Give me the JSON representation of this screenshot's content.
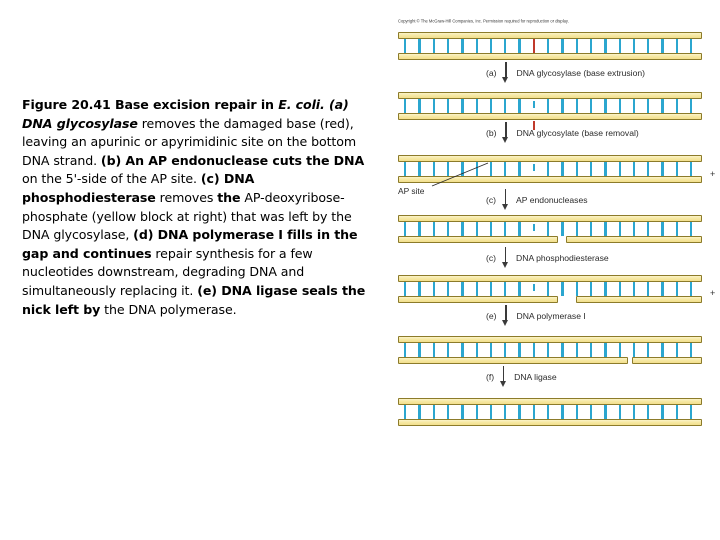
{
  "caption": {
    "segments": [
      {
        "style": "b",
        "text": "Figure 20.41 Base excision repair in "
      },
      {
        "style": "bi",
        "text": "E. coli. (a)"
      },
      {
        "style": "b",
        "text": " "
      },
      {
        "style": "bi",
        "text": "DNA glycosylase"
      },
      {
        "style": "r",
        "text": " removes the damaged base (red), leaving an apurinic or apyrimidinic site on the bottom DNA strand. "
      },
      {
        "style": "b",
        "text": "(b) An AP endonuclease cuts the DNA"
      },
      {
        "style": "r",
        "text": " on the 5'-side of the AP site. "
      },
      {
        "style": "b",
        "text": "(c) DNA phosphodiesterase"
      },
      {
        "style": "r",
        "text": " removes "
      },
      {
        "style": "b",
        "text": "the"
      },
      {
        "style": "r",
        "text": " AP-deoxyribose-phosphate (yellow block at right) that was left by the DNA glycosylase, "
      },
      {
        "style": "b",
        "text": "(d) DNA polymerase I fills in the gap and continues"
      },
      {
        "style": "r",
        "text": " repair synthesis for a few nucleotides downstream, degrading DNA and simultaneously replacing it. "
      },
      {
        "style": "b",
        "text": "(e) DNA ligase seals the nick left by"
      },
      {
        "style": "r",
        "text": " the DNA polymerase."
      }
    ]
  },
  "diagram": {
    "copyright": "Copyright © The McGraw-Hill Companies, Inc. Permission required for reproduction or display.",
    "ap_site_label": "AP site",
    "plus_symbol": "+",
    "steps": [
      {
        "tag": "(a)",
        "label": "DNA glycosylase (base extrusion)"
      },
      {
        "tag": "(b)",
        "label": "DNA glycosylate (base removal)"
      },
      {
        "tag": "(c)",
        "label": "AP endonucleases"
      },
      {
        "tag": "(c)",
        "label": "DNA phosphodiesterase"
      },
      {
        "tag": "(e)",
        "label": "DNA polymerase I"
      },
      {
        "tag": "(f)",
        "label": "DNA ligase"
      }
    ]
  },
  "colors": {
    "backbone_fill": "#f7e9a4",
    "backbone_border": "#8c7b2a",
    "base_pair": "#2ba6cf",
    "damaged_base": "#c0392b",
    "free_base": "#d4627a",
    "background": "#ffffff",
    "text": "#000000"
  }
}
